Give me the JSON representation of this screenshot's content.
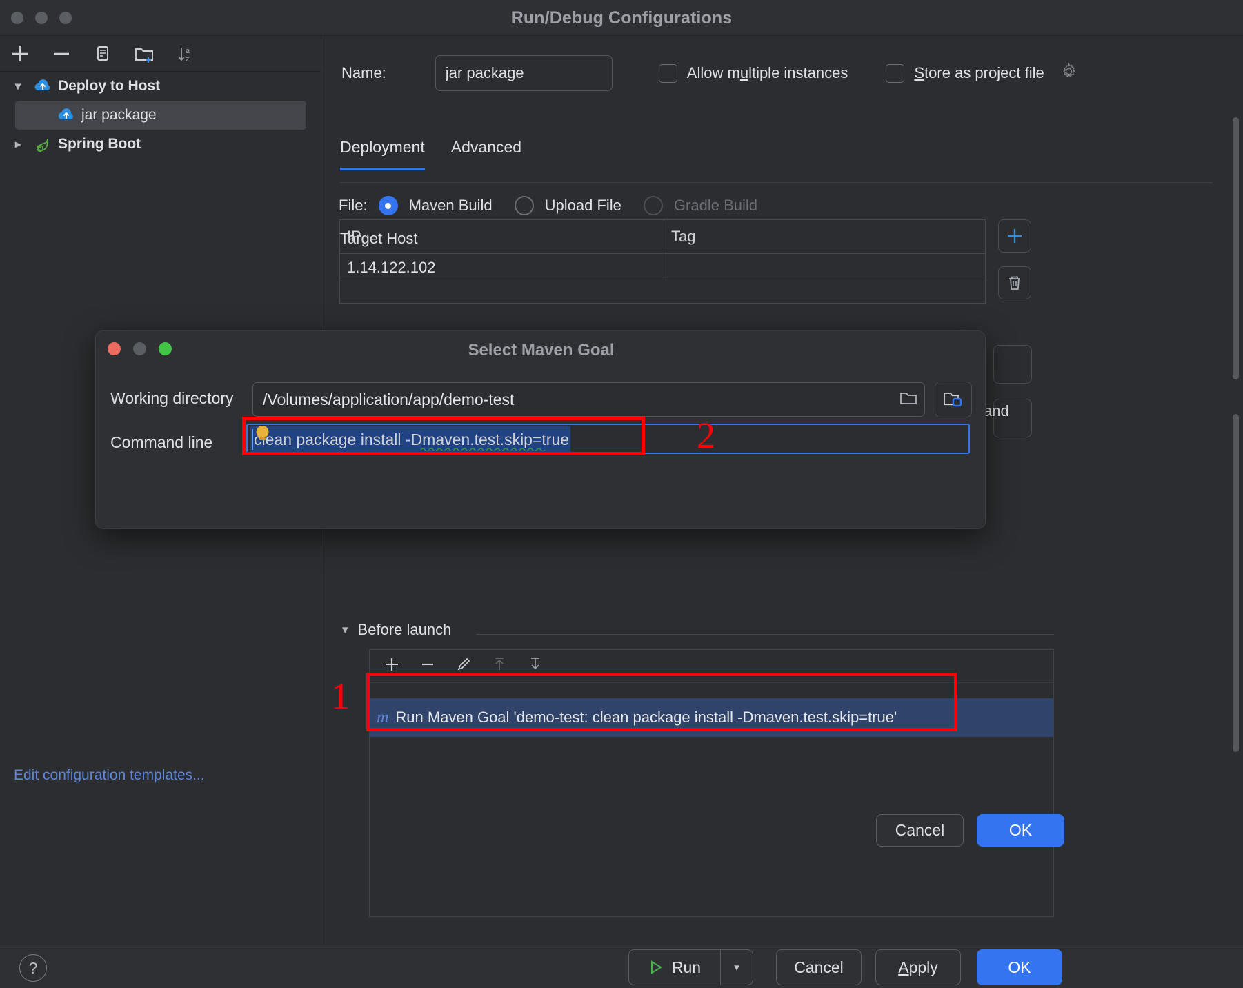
{
  "window": {
    "title": "Run/Debug Configurations"
  },
  "left_toolbar": {
    "add": "add-icon",
    "remove": "remove-icon",
    "copy": "copy-icon",
    "new_folder": "new-folder-icon",
    "sort": "sort-alphabetically-icon"
  },
  "tree": {
    "items": [
      {
        "label": "Deploy to Host",
        "type": "group",
        "expanded": true,
        "icon": "cloud-upload-icon"
      },
      {
        "label": "jar package",
        "type": "child",
        "selected": true,
        "icon": "cloud-upload-icon"
      },
      {
        "label": "Spring Boot",
        "type": "group",
        "expanded": false,
        "icon": "spring-leaf-icon"
      }
    ],
    "edit_templates_link": "Edit configuration templates..."
  },
  "config": {
    "name_label": "Name:",
    "name_value": "jar package",
    "allow_multiple_instances": {
      "label_pre": "Allow m",
      "label_underlined": "u",
      "label_post": "ltiple instances",
      "checked": false
    },
    "store_as_project_file": {
      "label_underlined": "S",
      "label_post": "tore as project file",
      "checked": false,
      "gear": "gear-icon"
    },
    "tabs": [
      {
        "label": "Deployment",
        "active": true
      },
      {
        "label": "Advanced",
        "active": false
      }
    ],
    "file_row": {
      "label": "File:",
      "options": [
        {
          "label": "Maven Build",
          "selected": true,
          "disabled": false
        },
        {
          "label": "Upload File",
          "selected": false,
          "disabled": false
        },
        {
          "label": "Gradle Build",
          "selected": false,
          "disabled": true
        }
      ]
    },
    "target_host": {
      "label": "Target Host",
      "columns": [
        "IP",
        "Tag"
      ],
      "rows": [
        {
          "ip": "1.14.122.102",
          "tag": ""
        }
      ],
      "add_button": "add-icon",
      "delete_button": "trash-icon"
    },
    "before_launch": {
      "title": "Before launch",
      "toolbar": [
        "add-icon",
        "remove-icon",
        "edit-pencil-icon",
        "move-up-icon",
        "move-down-icon"
      ],
      "rows": [
        {
          "icon": "maven-m-icon",
          "label": "Run Maven Goal 'demo-test: clean package install -Dmaven.test.skip=true'",
          "selected": true
        }
      ]
    }
  },
  "dialog": {
    "title": "Select Maven Goal",
    "working_directory_label": "Working directory",
    "working_directory_value": "/Volumes/application/app/demo-test",
    "working_directory_folder_icon": "folder-icon",
    "browse_button_icon": "folder-module-icon",
    "command_line_label": "Command line",
    "command_line_value": "clean package install -Dmaven.test.skip=true",
    "hint_icon": "lightbulb-icon",
    "cancel_label": "Cancel",
    "ok_label": "OK"
  },
  "bottom_bar": {
    "help": "?",
    "run_label": "Run",
    "run_icon": "play-icon",
    "run_dropdown": "chevron-down-icon",
    "cancel_label": "Cancel",
    "apply_label_underlined": "A",
    "apply_label_post": "pply",
    "ok_label": "OK"
  },
  "annotations": [
    {
      "number": "1",
      "target": "before-launch-row"
    },
    {
      "number": "2",
      "target": "command-line-field"
    }
  ],
  "colors": {
    "accent_blue": "#3574f0",
    "annotation_red": "#fb0007",
    "link_blue": "#5d87d6",
    "selection_blue": "#214283",
    "row_selection": "#2f436b"
  }
}
